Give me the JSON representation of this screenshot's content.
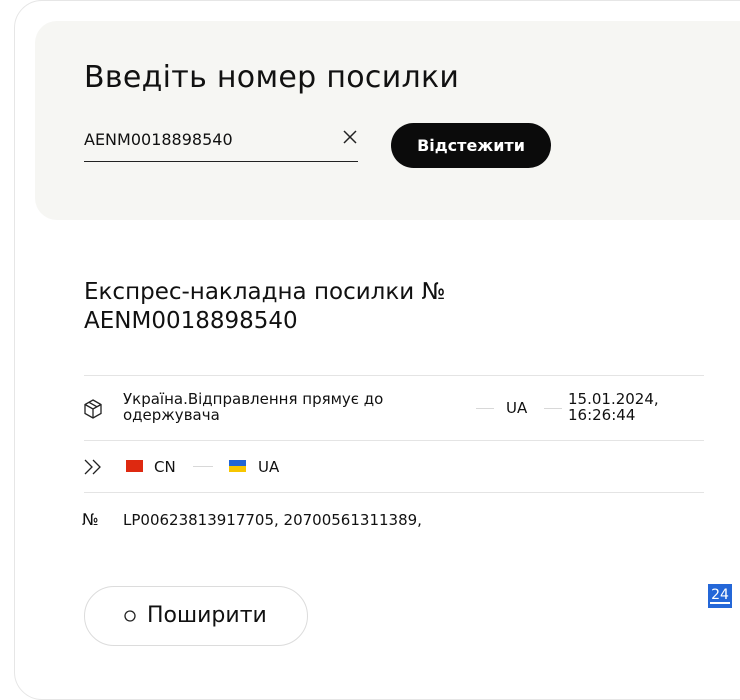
{
  "search": {
    "title": "Введіть номер посилки",
    "value": "AENM0018898540",
    "button_label": "Відстежити"
  },
  "waybill": {
    "title_line1": "Експрес-накладна посилки №",
    "title_line2": "AENM0018898540"
  },
  "status": {
    "text": "Україна.Відправлення прямує до одержувача",
    "country_code": "UA",
    "datetime_line1": "15.01.2024,",
    "datetime_line2": "16:26:44"
  },
  "route": {
    "from_code": "CN",
    "to_code": "UA"
  },
  "numbers": {
    "sign": "№",
    "value": "LP00623813917705, 20700561311389,"
  },
  "share": {
    "label": "Поширити"
  },
  "badge": {
    "label": "24"
  },
  "colors": {
    "accent": "#0b0b0b",
    "panel_bg": "#f6f6f3",
    "badge": "#2467d8"
  }
}
